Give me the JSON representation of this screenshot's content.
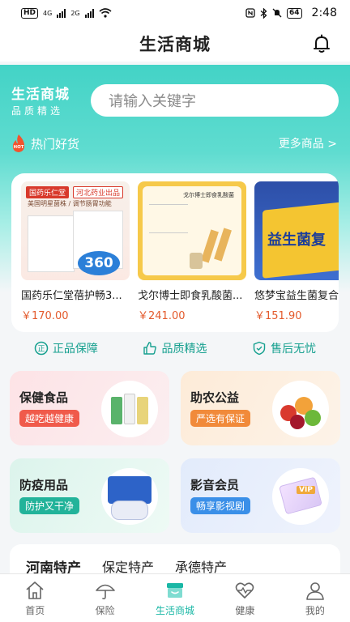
{
  "status_bar": {
    "hd": "HD",
    "net1": "4G",
    "net2": "2G",
    "battery": "64",
    "time": "2:48"
  },
  "header": {
    "title": "生活商城"
  },
  "hero": {
    "brand_title": "生活商城",
    "brand_subtitle": "品质精选",
    "search_placeholder": "请输入关键字",
    "hot_badge": "HOT",
    "hot_title": "热门好货",
    "more_label": "更多商品 >"
  },
  "goods": [
    {
      "name": "国药乐仁堂蓓护畅3...",
      "price": "￥170.00",
      "img_text_1": "国药乐仁堂",
      "img_text_2": "河北药业出品",
      "img_text_3": "美国明星菌株 / 调节肠胃功能",
      "img_big": "360"
    },
    {
      "name": "戈尔博士即食乳酸菌...",
      "price": "￥241.00",
      "img_text_1": "戈尔博士即食乳酸菌"
    },
    {
      "name": "悠梦宝益生菌复合...",
      "price": "￥151.90",
      "img_text_1": "益生菌复"
    }
  ],
  "guarantees": [
    {
      "icon": "shield-check-icon",
      "label": "正品保障"
    },
    {
      "icon": "thumbs-up-icon",
      "label": "品质精选"
    },
    {
      "icon": "shield-tick-icon",
      "label": "售后无忧"
    }
  ],
  "categories": [
    {
      "title": "保健食品",
      "pill": "越吃越健康",
      "pill_color": "#f05a4b",
      "bg": "#fde8ea"
    },
    {
      "title": "助农公益",
      "pill": "严选有保证",
      "pill_color": "#f18a3a",
      "bg": "#fdf0e2"
    },
    {
      "title": "防疫用品",
      "pill": "防护又干净",
      "pill_color": "#22b39a",
      "bg": "#e2f6ef"
    },
    {
      "title": "影音会员",
      "pill": "畅享影视剧",
      "pill_color": "#3a8fe8",
      "bg": "#e8effc"
    }
  ],
  "regions": [
    "河南特产",
    "保定特产",
    "承德特产"
  ],
  "tabbar": [
    {
      "label": "首页",
      "icon": "home-icon"
    },
    {
      "label": "保险",
      "icon": "umbrella-icon"
    },
    {
      "label": "生活商城",
      "icon": "store-icon",
      "active": true
    },
    {
      "label": "健康",
      "icon": "heart-pulse-icon"
    },
    {
      "label": "我的",
      "icon": "user-icon"
    }
  ],
  "colors": {
    "accent": "#19b7a5",
    "price": "#e35a2c",
    "hero": "#43d3c6"
  }
}
